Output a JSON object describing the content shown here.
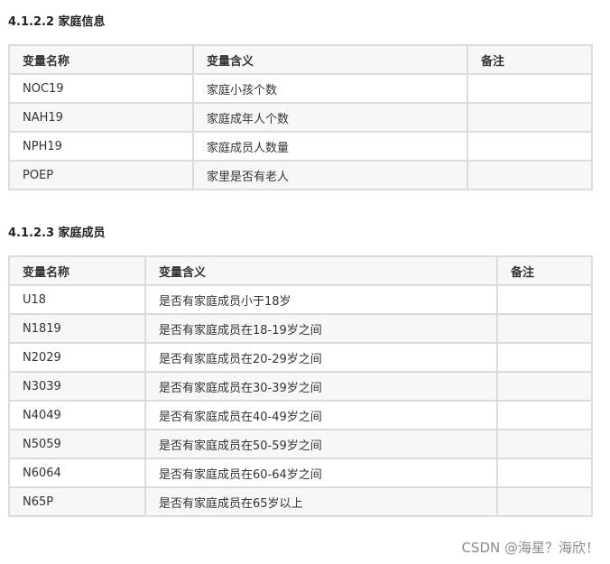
{
  "sections": [
    {
      "title": "4.1.2.2 家庭信息",
      "headers": [
        "变量名称",
        "变量含义",
        "备注"
      ],
      "rows": [
        [
          "NOC19",
          "家庭小孩个数",
          ""
        ],
        [
          "NAH19",
          "家庭成年人个数",
          ""
        ],
        [
          "NPH19",
          "家庭成员人数量",
          ""
        ],
        [
          "POEP",
          "家里是否有老人",
          ""
        ]
      ]
    },
    {
      "title": "4.1.2.3 家庭成员",
      "headers": [
        "变量名称",
        "变量含义",
        "备注"
      ],
      "rows": [
        [
          "U18",
          "是否有家庭成员小于18岁",
          ""
        ],
        [
          "N1819",
          "是否有家庭成员在18-19岁之间",
          ""
        ],
        [
          "N2029",
          "是否有家庭成员在20-29岁之间",
          ""
        ],
        [
          "N3039",
          "是否有家庭成员在30-39岁之间",
          ""
        ],
        [
          "N4049",
          "是否有家庭成员在40-49岁之间",
          ""
        ],
        [
          "N5059",
          "是否有家庭成员在50-59岁之间",
          ""
        ],
        [
          "N6064",
          "是否有家庭成员在60-64岁之间",
          ""
        ],
        [
          "N65P",
          "是否有家庭成员在65岁以上",
          ""
        ]
      ]
    }
  ],
  "watermark": "CSDN @海星？海欣！"
}
